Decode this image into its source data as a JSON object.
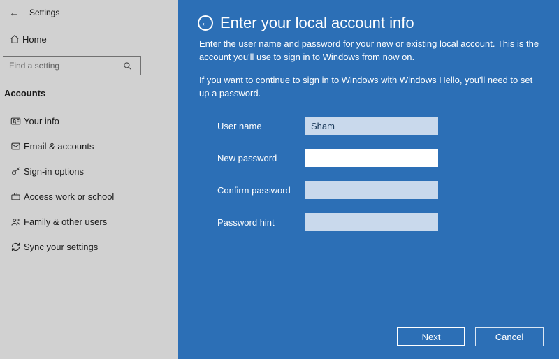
{
  "settings": {
    "title": "Settings",
    "home_label": "Home",
    "search_placeholder": "Find a setting",
    "section_header": "Accounts",
    "nav": [
      {
        "label": "Your info"
      },
      {
        "label": "Email & accounts"
      },
      {
        "label": "Sign-in options"
      },
      {
        "label": "Access work or school"
      },
      {
        "label": "Family & other users"
      },
      {
        "label": "Sync your settings"
      }
    ]
  },
  "modal": {
    "title": "Enter your local account info",
    "para1": "Enter the user name and password for your new or existing local account. This is the account you'll use to sign in to Windows from now on.",
    "para2": "If you want to continue to sign in to Windows with Windows Hello, you'll need to set up a password.",
    "fields": {
      "username_label": "User name",
      "username_value": "Sham",
      "newpw_label": "New password",
      "newpw_value": "",
      "confirmpw_label": "Confirm password",
      "confirmpw_value": "",
      "hint_label": "Password hint",
      "hint_value": ""
    },
    "buttons": {
      "next": "Next",
      "cancel": "Cancel"
    }
  }
}
